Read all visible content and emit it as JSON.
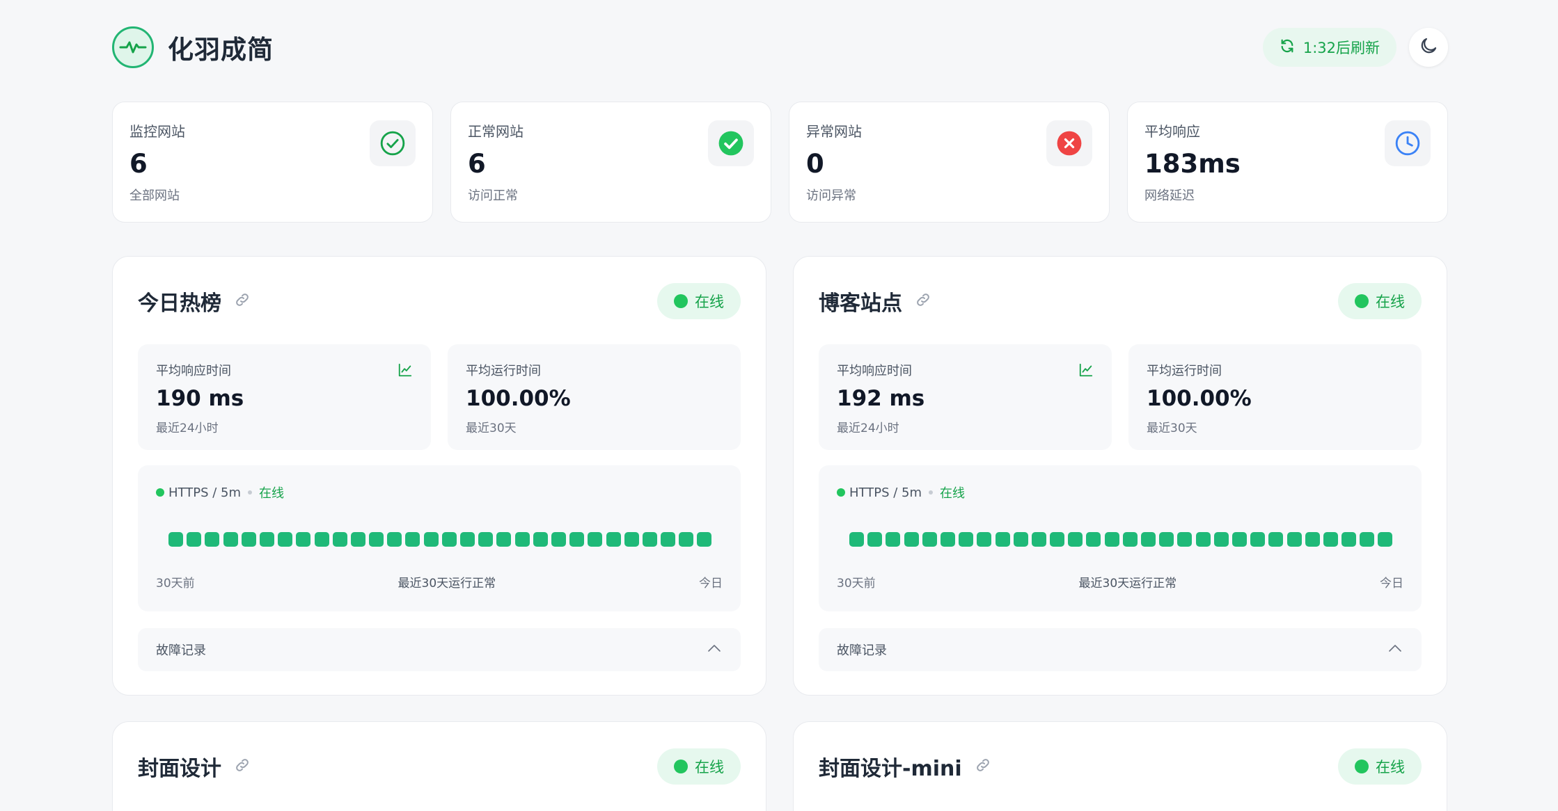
{
  "app": {
    "title": "化羽成简",
    "refresh_label": "1:32后刷新"
  },
  "stats": [
    {
      "label": "监控网站",
      "value": "6",
      "sub": "全部网站",
      "icon": "check-circle-outline-icon",
      "color": "#16a34a"
    },
    {
      "label": "正常网站",
      "value": "6",
      "sub": "访问正常",
      "icon": "check-circle-filled-icon",
      "color": "#22c55e"
    },
    {
      "label": "异常网站",
      "value": "0",
      "sub": "访问异常",
      "icon": "x-circle-filled-icon",
      "color": "#ef4444"
    },
    {
      "label": "平均响应",
      "value": "183ms",
      "sub": "网络延迟",
      "icon": "clock-icon",
      "color": "#3b82f6"
    }
  ],
  "sites": [
    {
      "name": "今日热榜",
      "status": "在线",
      "avg_response_label": "平均响应时间",
      "avg_response": "190 ms",
      "avg_response_sub": "最近24小时",
      "uptime_label": "平均运行时间",
      "uptime": "100.00%",
      "uptime_sub": "最近30天",
      "protocol": "HTTPS / 5m",
      "protocol_status": "在线",
      "history_start": "30天前",
      "history_summary": "最近30天运行正常",
      "history_end": "今日",
      "faults_label": "故障记录"
    },
    {
      "name": "博客站点",
      "status": "在线",
      "avg_response_label": "平均响应时间",
      "avg_response": "192 ms",
      "avg_response_sub": "最近24小时",
      "uptime_label": "平均运行时间",
      "uptime": "100.00%",
      "uptime_sub": "最近30天",
      "protocol": "HTTPS / 5m",
      "protocol_status": "在线",
      "history_start": "30天前",
      "history_summary": "最近30天运行正常",
      "history_end": "今日",
      "faults_label": "故障记录"
    },
    {
      "name": "封面设计",
      "status": "在线"
    },
    {
      "name": "封面设计-mini",
      "status": "在线"
    }
  ],
  "colors": {
    "accent": "#16a34a",
    "bar_ok": "#1fb978",
    "background": "#f6f7f9"
  }
}
